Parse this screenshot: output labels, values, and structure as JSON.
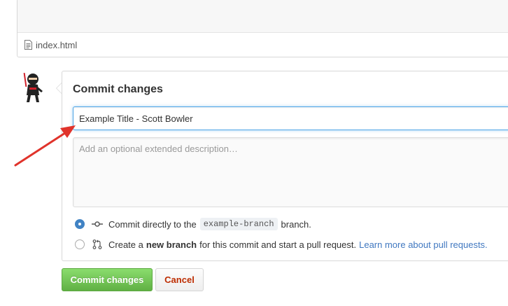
{
  "file": {
    "name": "index.html",
    "icon": "file-text-icon"
  },
  "commit_panel": {
    "title": "Commit changes",
    "summary_value": "Example Title - Scott Bowler",
    "description_placeholder": "Add an optional extended description…",
    "options": {
      "direct": {
        "selected": true,
        "icon": "git-commit-icon",
        "prefix": "Commit directly to the",
        "branch": "example-branch",
        "suffix": "branch."
      },
      "new_branch": {
        "selected": false,
        "icon": "git-pull-request-icon",
        "prefix": "Create a",
        "bold": "new branch",
        "suffix": "for this commit and start a pull request.",
        "link": "Learn more about pull requests."
      }
    }
  },
  "buttons": {
    "commit": "Commit changes",
    "cancel": "Cancel"
  },
  "colors": {
    "focus_border": "#51a7e8",
    "commit_green": "#60b044",
    "cancel_red": "#bd2c00",
    "link_blue": "#4078c0",
    "annotation_red": "#e0332b"
  }
}
